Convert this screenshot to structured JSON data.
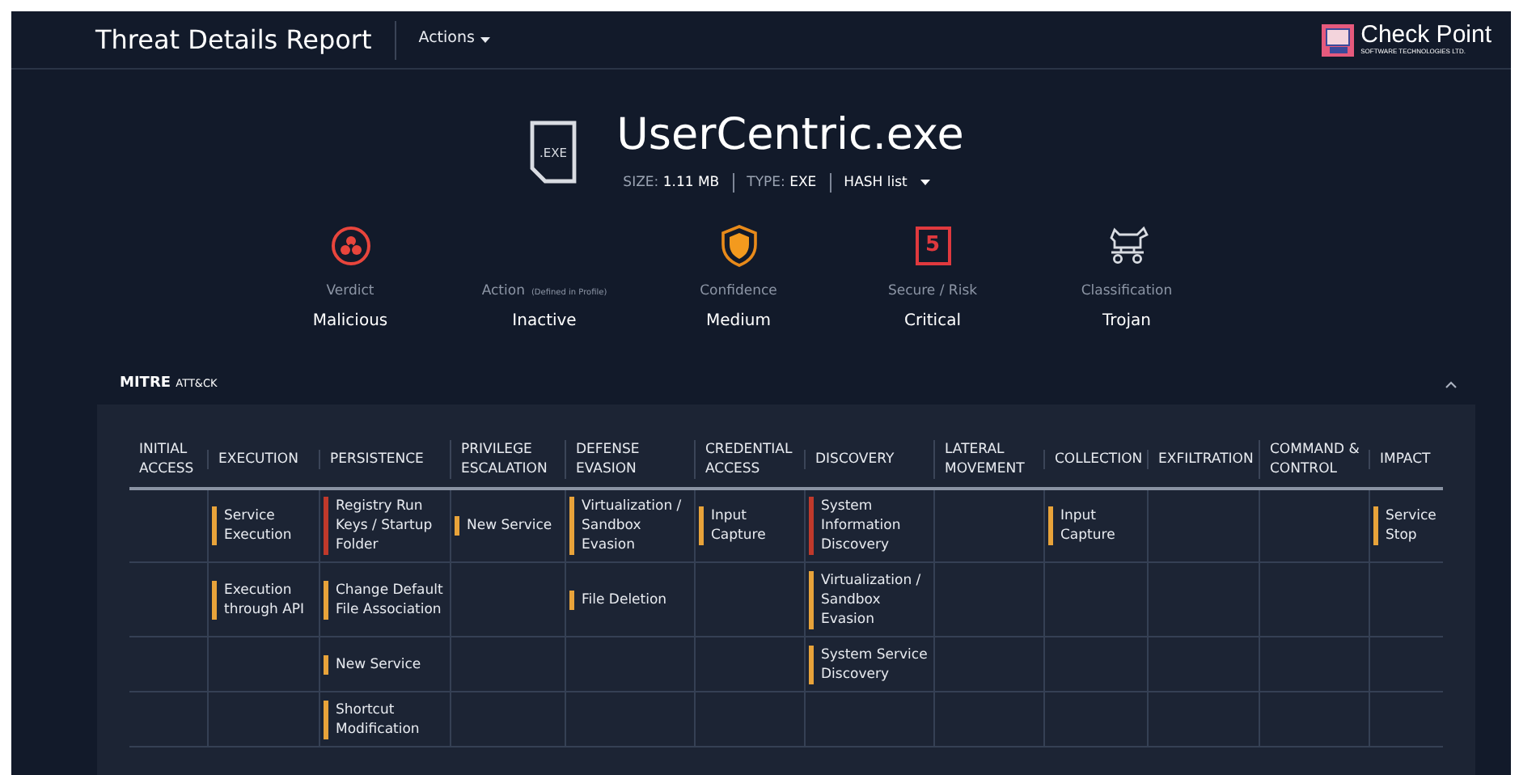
{
  "header": {
    "title": "Threat Details Report",
    "actions": "Actions",
    "logo_name": "Check Point",
    "logo_sub": "SOFTWARE TECHNOLOGIES LTD."
  },
  "file": {
    "icon_label": ".EXE",
    "name": "UserCentric.exe",
    "size_label": "SIZE:",
    "size": "1.11 MB",
    "type_label": "TYPE:",
    "type": "EXE",
    "hash": "HASH list"
  },
  "summary": [
    {
      "kind": "verdict",
      "label": "Verdict",
      "value": "Malicious"
    },
    {
      "kind": "action",
      "label": "Action",
      "note": "(Defined in Profile)",
      "value": "Inactive"
    },
    {
      "kind": "confidence",
      "label": "Confidence",
      "value": "Medium"
    },
    {
      "kind": "risk",
      "label": "Secure / Risk",
      "badge": "5",
      "value": "Critical"
    },
    {
      "kind": "classification",
      "label": "Classification",
      "value": "Trojan"
    }
  ],
  "mitre": {
    "title": "MITRE",
    "subtitle": "ATT&CK",
    "expanded": true,
    "columns": [
      {
        "label": "INITIAL ACCESS"
      },
      {
        "label": "EXECUTION",
        "techniques": [
          {
            "text": "Service Execution",
            "color": "#e8a33a"
          },
          {
            "text": "Execution through API",
            "color": "#e8a33a"
          }
        ]
      },
      {
        "label": "PERSISTENCE",
        "techniques": [
          {
            "text": "Registry Run Keys / Startup Folder",
            "color": "#c0392b"
          },
          {
            "text": "Change Default File Association",
            "color": "#e8a33a"
          },
          {
            "text": "New Service",
            "color": "#e8a33a"
          },
          {
            "text": "Shortcut Modification",
            "color": "#e8a33a"
          }
        ]
      },
      {
        "label": "PRIVILEGE ESCALATION",
        "techniques": [
          {
            "text": "New Service",
            "color": "#e8a33a"
          }
        ]
      },
      {
        "label": "DEFENSE EVASION",
        "techniques": [
          {
            "text": "Virtualization / Sandbox Evasion",
            "color": "#e8a33a"
          },
          {
            "text": "File Deletion",
            "color": "#e8a33a"
          }
        ]
      },
      {
        "label": "CREDENTIAL ACCESS",
        "techniques": [
          {
            "text": "Input Capture",
            "color": "#e8a33a"
          }
        ]
      },
      {
        "label": "DISCOVERY",
        "techniques": [
          {
            "text": "System Information Discovery",
            "color": "#c0392b"
          },
          {
            "text": "Virtualization / Sandbox Evasion",
            "color": "#e8a33a"
          },
          {
            "text": "System Service Discovery",
            "color": "#e8a33a"
          }
        ]
      },
      {
        "label": "LATERAL MOVEMENT"
      },
      {
        "label": "COLLECTION",
        "techniques": [
          {
            "text": "Input Capture",
            "color": "#e8a33a"
          }
        ]
      },
      {
        "label": "EXFILTRATION"
      },
      {
        "label": "COMMAND & CONTROL"
      },
      {
        "label": "IMPACT",
        "techniques": [
          {
            "text": "Service Stop",
            "color": "#e8a33a"
          }
        ]
      }
    ]
  }
}
